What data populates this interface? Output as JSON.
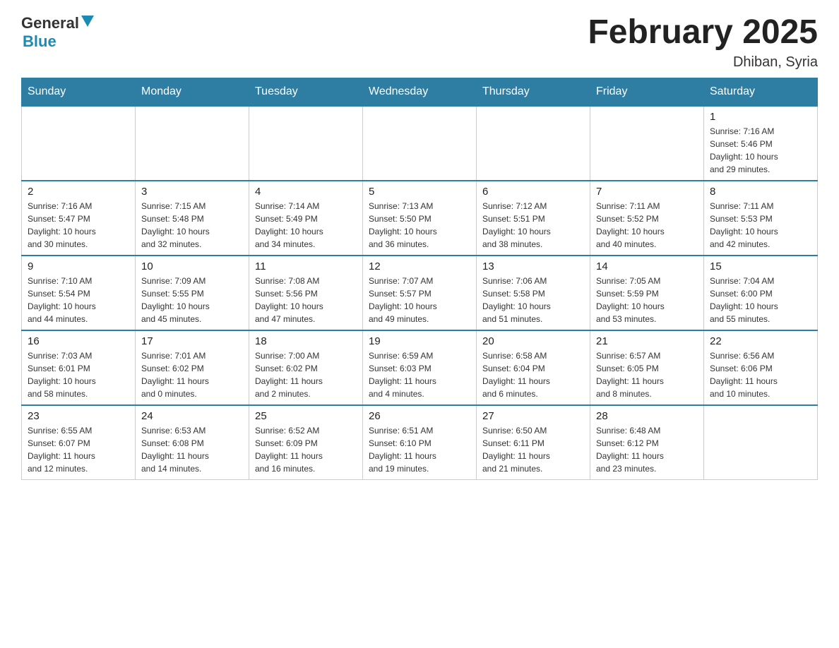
{
  "header": {
    "logo_general": "General",
    "logo_blue": "Blue",
    "month_title": "February 2025",
    "location": "Dhiban, Syria"
  },
  "weekdays": [
    "Sunday",
    "Monday",
    "Tuesday",
    "Wednesday",
    "Thursday",
    "Friday",
    "Saturday"
  ],
  "weeks": [
    [
      {
        "day": "",
        "info": ""
      },
      {
        "day": "",
        "info": ""
      },
      {
        "day": "",
        "info": ""
      },
      {
        "day": "",
        "info": ""
      },
      {
        "day": "",
        "info": ""
      },
      {
        "day": "",
        "info": ""
      },
      {
        "day": "1",
        "info": "Sunrise: 7:16 AM\nSunset: 5:46 PM\nDaylight: 10 hours\nand 29 minutes."
      }
    ],
    [
      {
        "day": "2",
        "info": "Sunrise: 7:16 AM\nSunset: 5:47 PM\nDaylight: 10 hours\nand 30 minutes."
      },
      {
        "day": "3",
        "info": "Sunrise: 7:15 AM\nSunset: 5:48 PM\nDaylight: 10 hours\nand 32 minutes."
      },
      {
        "day": "4",
        "info": "Sunrise: 7:14 AM\nSunset: 5:49 PM\nDaylight: 10 hours\nand 34 minutes."
      },
      {
        "day": "5",
        "info": "Sunrise: 7:13 AM\nSunset: 5:50 PM\nDaylight: 10 hours\nand 36 minutes."
      },
      {
        "day": "6",
        "info": "Sunrise: 7:12 AM\nSunset: 5:51 PM\nDaylight: 10 hours\nand 38 minutes."
      },
      {
        "day": "7",
        "info": "Sunrise: 7:11 AM\nSunset: 5:52 PM\nDaylight: 10 hours\nand 40 minutes."
      },
      {
        "day": "8",
        "info": "Sunrise: 7:11 AM\nSunset: 5:53 PM\nDaylight: 10 hours\nand 42 minutes."
      }
    ],
    [
      {
        "day": "9",
        "info": "Sunrise: 7:10 AM\nSunset: 5:54 PM\nDaylight: 10 hours\nand 44 minutes."
      },
      {
        "day": "10",
        "info": "Sunrise: 7:09 AM\nSunset: 5:55 PM\nDaylight: 10 hours\nand 45 minutes."
      },
      {
        "day": "11",
        "info": "Sunrise: 7:08 AM\nSunset: 5:56 PM\nDaylight: 10 hours\nand 47 minutes."
      },
      {
        "day": "12",
        "info": "Sunrise: 7:07 AM\nSunset: 5:57 PM\nDaylight: 10 hours\nand 49 minutes."
      },
      {
        "day": "13",
        "info": "Sunrise: 7:06 AM\nSunset: 5:58 PM\nDaylight: 10 hours\nand 51 minutes."
      },
      {
        "day": "14",
        "info": "Sunrise: 7:05 AM\nSunset: 5:59 PM\nDaylight: 10 hours\nand 53 minutes."
      },
      {
        "day": "15",
        "info": "Sunrise: 7:04 AM\nSunset: 6:00 PM\nDaylight: 10 hours\nand 55 minutes."
      }
    ],
    [
      {
        "day": "16",
        "info": "Sunrise: 7:03 AM\nSunset: 6:01 PM\nDaylight: 10 hours\nand 58 minutes."
      },
      {
        "day": "17",
        "info": "Sunrise: 7:01 AM\nSunset: 6:02 PM\nDaylight: 11 hours\nand 0 minutes."
      },
      {
        "day": "18",
        "info": "Sunrise: 7:00 AM\nSunset: 6:02 PM\nDaylight: 11 hours\nand 2 minutes."
      },
      {
        "day": "19",
        "info": "Sunrise: 6:59 AM\nSunset: 6:03 PM\nDaylight: 11 hours\nand 4 minutes."
      },
      {
        "day": "20",
        "info": "Sunrise: 6:58 AM\nSunset: 6:04 PM\nDaylight: 11 hours\nand 6 minutes."
      },
      {
        "day": "21",
        "info": "Sunrise: 6:57 AM\nSunset: 6:05 PM\nDaylight: 11 hours\nand 8 minutes."
      },
      {
        "day": "22",
        "info": "Sunrise: 6:56 AM\nSunset: 6:06 PM\nDaylight: 11 hours\nand 10 minutes."
      }
    ],
    [
      {
        "day": "23",
        "info": "Sunrise: 6:55 AM\nSunset: 6:07 PM\nDaylight: 11 hours\nand 12 minutes."
      },
      {
        "day": "24",
        "info": "Sunrise: 6:53 AM\nSunset: 6:08 PM\nDaylight: 11 hours\nand 14 minutes."
      },
      {
        "day": "25",
        "info": "Sunrise: 6:52 AM\nSunset: 6:09 PM\nDaylight: 11 hours\nand 16 minutes."
      },
      {
        "day": "26",
        "info": "Sunrise: 6:51 AM\nSunset: 6:10 PM\nDaylight: 11 hours\nand 19 minutes."
      },
      {
        "day": "27",
        "info": "Sunrise: 6:50 AM\nSunset: 6:11 PM\nDaylight: 11 hours\nand 21 minutes."
      },
      {
        "day": "28",
        "info": "Sunrise: 6:48 AM\nSunset: 6:12 PM\nDaylight: 11 hours\nand 23 minutes."
      },
      {
        "day": "",
        "info": ""
      }
    ]
  ]
}
